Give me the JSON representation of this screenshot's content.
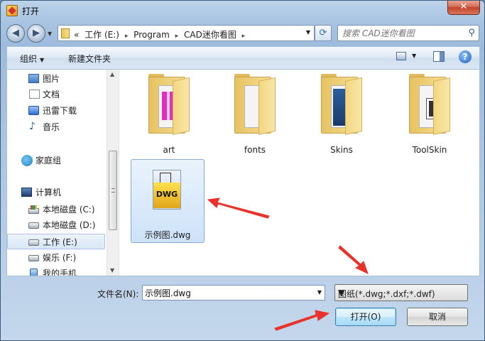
{
  "window": {
    "title": "打开",
    "close_label": "✕"
  },
  "address": {
    "back_icon": "back-arrow-icon",
    "forward_icon": "forward-arrow-icon",
    "overflow": "«",
    "crumbs": [
      "工作 (E:)",
      "Program",
      "CAD迷你看图"
    ],
    "search_placeholder": "搜索 CAD迷你看图"
  },
  "toolbar": {
    "organize": "组织",
    "new_folder": "新建文件夹",
    "help": "?"
  },
  "nav": {
    "items": [
      {
        "label": "图片",
        "icon": "pictures-icon"
      },
      {
        "label": "文档",
        "icon": "documents-icon"
      },
      {
        "label": "迅雷下载",
        "icon": "thunder-download-icon"
      },
      {
        "label": "音乐",
        "icon": "music-icon"
      },
      {
        "label": "家庭组",
        "icon": "homegroup-icon"
      },
      {
        "label": "计算机",
        "icon": "computer-icon"
      },
      {
        "label": "本地磁盘 (C:)",
        "icon": "system-drive-icon"
      },
      {
        "label": "本地磁盘 (D:)",
        "icon": "drive-icon"
      },
      {
        "label": "工作 (E:)",
        "icon": "drive-icon",
        "selected": true
      },
      {
        "label": "娱乐 (F:)",
        "icon": "drive-icon"
      },
      {
        "label": "我的手机",
        "icon": "phone-icon"
      }
    ]
  },
  "files": [
    {
      "name": "art",
      "type": "folder"
    },
    {
      "name": "fonts",
      "type": "folder"
    },
    {
      "name": "Skins",
      "type": "folder"
    },
    {
      "name": "ToolSkin",
      "type": "folder"
    },
    {
      "name": "示例图.dwg",
      "type": "dwg",
      "selected": true,
      "badge": "DWG"
    }
  ],
  "bottom": {
    "filename_label": "文件名(N):",
    "filename_value": "示例图.dwg",
    "filetype_value": "图纸(*.dwg;*.dxf;*.dwf)",
    "open_label": "打开(O)",
    "cancel_label": "取消"
  },
  "colors": {
    "annotation_arrow": "#e8322a",
    "selection": "#cde2f9"
  }
}
